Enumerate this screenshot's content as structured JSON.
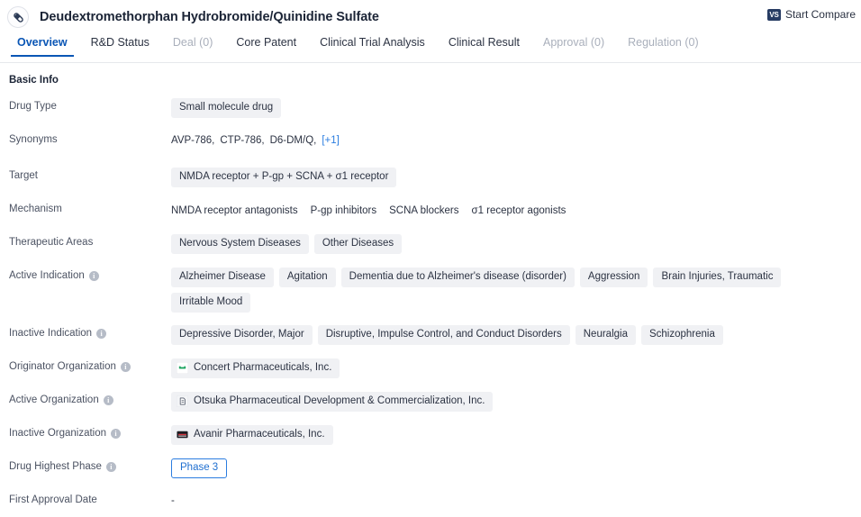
{
  "header": {
    "drug_icon": "capsule-icon",
    "title": "Deudextromethorphan Hydrobromide/Quinidine Sulfate",
    "compare": {
      "badge": "VS",
      "label": "Start Compare"
    }
  },
  "tabs": [
    {
      "label": "Overview",
      "state": "active"
    },
    {
      "label": "R&D Status",
      "state": "normal"
    },
    {
      "label": "Deal (0)",
      "state": "disabled"
    },
    {
      "label": "Core Patent",
      "state": "normal"
    },
    {
      "label": "Clinical Trial Analysis",
      "state": "normal"
    },
    {
      "label": "Clinical Result",
      "state": "normal"
    },
    {
      "label": "Approval (0)",
      "state": "disabled"
    },
    {
      "label": "Regulation (0)",
      "state": "disabled"
    }
  ],
  "section": {
    "title": "Basic Info"
  },
  "fields": {
    "drug_type": {
      "label": "Drug Type",
      "values": [
        "Small molecule drug"
      ]
    },
    "synonyms": {
      "label": "Synonyms",
      "values": [
        "AVP-786,",
        "CTP-786,",
        "D6-DM/Q,"
      ],
      "more": "[+1]"
    },
    "target": {
      "label": "Target",
      "values": [
        "NMDA receptor + P-gp + SCNA + σ1 receptor"
      ]
    },
    "mechanism": {
      "label": "Mechanism",
      "values": [
        "NMDA receptor antagonists",
        "P-gp inhibitors",
        "SCNA blockers",
        "σ1 receptor agonists"
      ]
    },
    "therapeutic_areas": {
      "label": "Therapeutic Areas",
      "values": [
        "Nervous System Diseases",
        "Other Diseases"
      ]
    },
    "active_indication": {
      "label": "Active Indication",
      "info": true,
      "values": [
        "Alzheimer Disease",
        "Agitation",
        "Dementia due to Alzheimer's disease (disorder)",
        "Aggression",
        "Brain Injuries, Traumatic",
        "Irritable Mood"
      ]
    },
    "inactive_indication": {
      "label": "Inactive Indication",
      "info": true,
      "values": [
        "Depressive Disorder, Major",
        "Disruptive, Impulse Control, and Conduct Disorders",
        "Neuralgia",
        "Schizophrenia"
      ]
    },
    "originator_organization": {
      "label": "Originator Organization",
      "info": true,
      "orgs": [
        {
          "name": "Concert Pharmaceuticals, Inc.",
          "logo": "concert-logo-icon",
          "logo_bg": "#ffffff",
          "logo_fg": "#13a05a"
        }
      ]
    },
    "active_organization": {
      "label": "Active Organization",
      "info": true,
      "orgs": [
        {
          "name": "Otsuka Pharmaceutical Development & Commercialization, Inc.",
          "logo": "otsuka-logo-icon",
          "logo_bg": "#f4f5f7",
          "logo_fg": "#4b5262"
        }
      ]
    },
    "inactive_organization": {
      "label": "Inactive Organization",
      "info": true,
      "orgs": [
        {
          "name": "Avanir Pharmaceuticals, Inc.",
          "logo": "avanir-logo-icon",
          "logo_bg": "#1d1d23",
          "logo_fg": "#d4333c"
        }
      ]
    },
    "drug_highest_phase": {
      "label": "Drug Highest Phase",
      "info": true,
      "badge": "Phase 3"
    },
    "first_approval_date": {
      "label": "First Approval Date",
      "value": "-"
    }
  },
  "colors": {
    "accent": "#0a56b5",
    "link": "#2b7de0",
    "chip_bg": "#f0f1f4",
    "text": "#2b3242",
    "muted": "#a9afbb",
    "vs_badge": "#273c63"
  }
}
